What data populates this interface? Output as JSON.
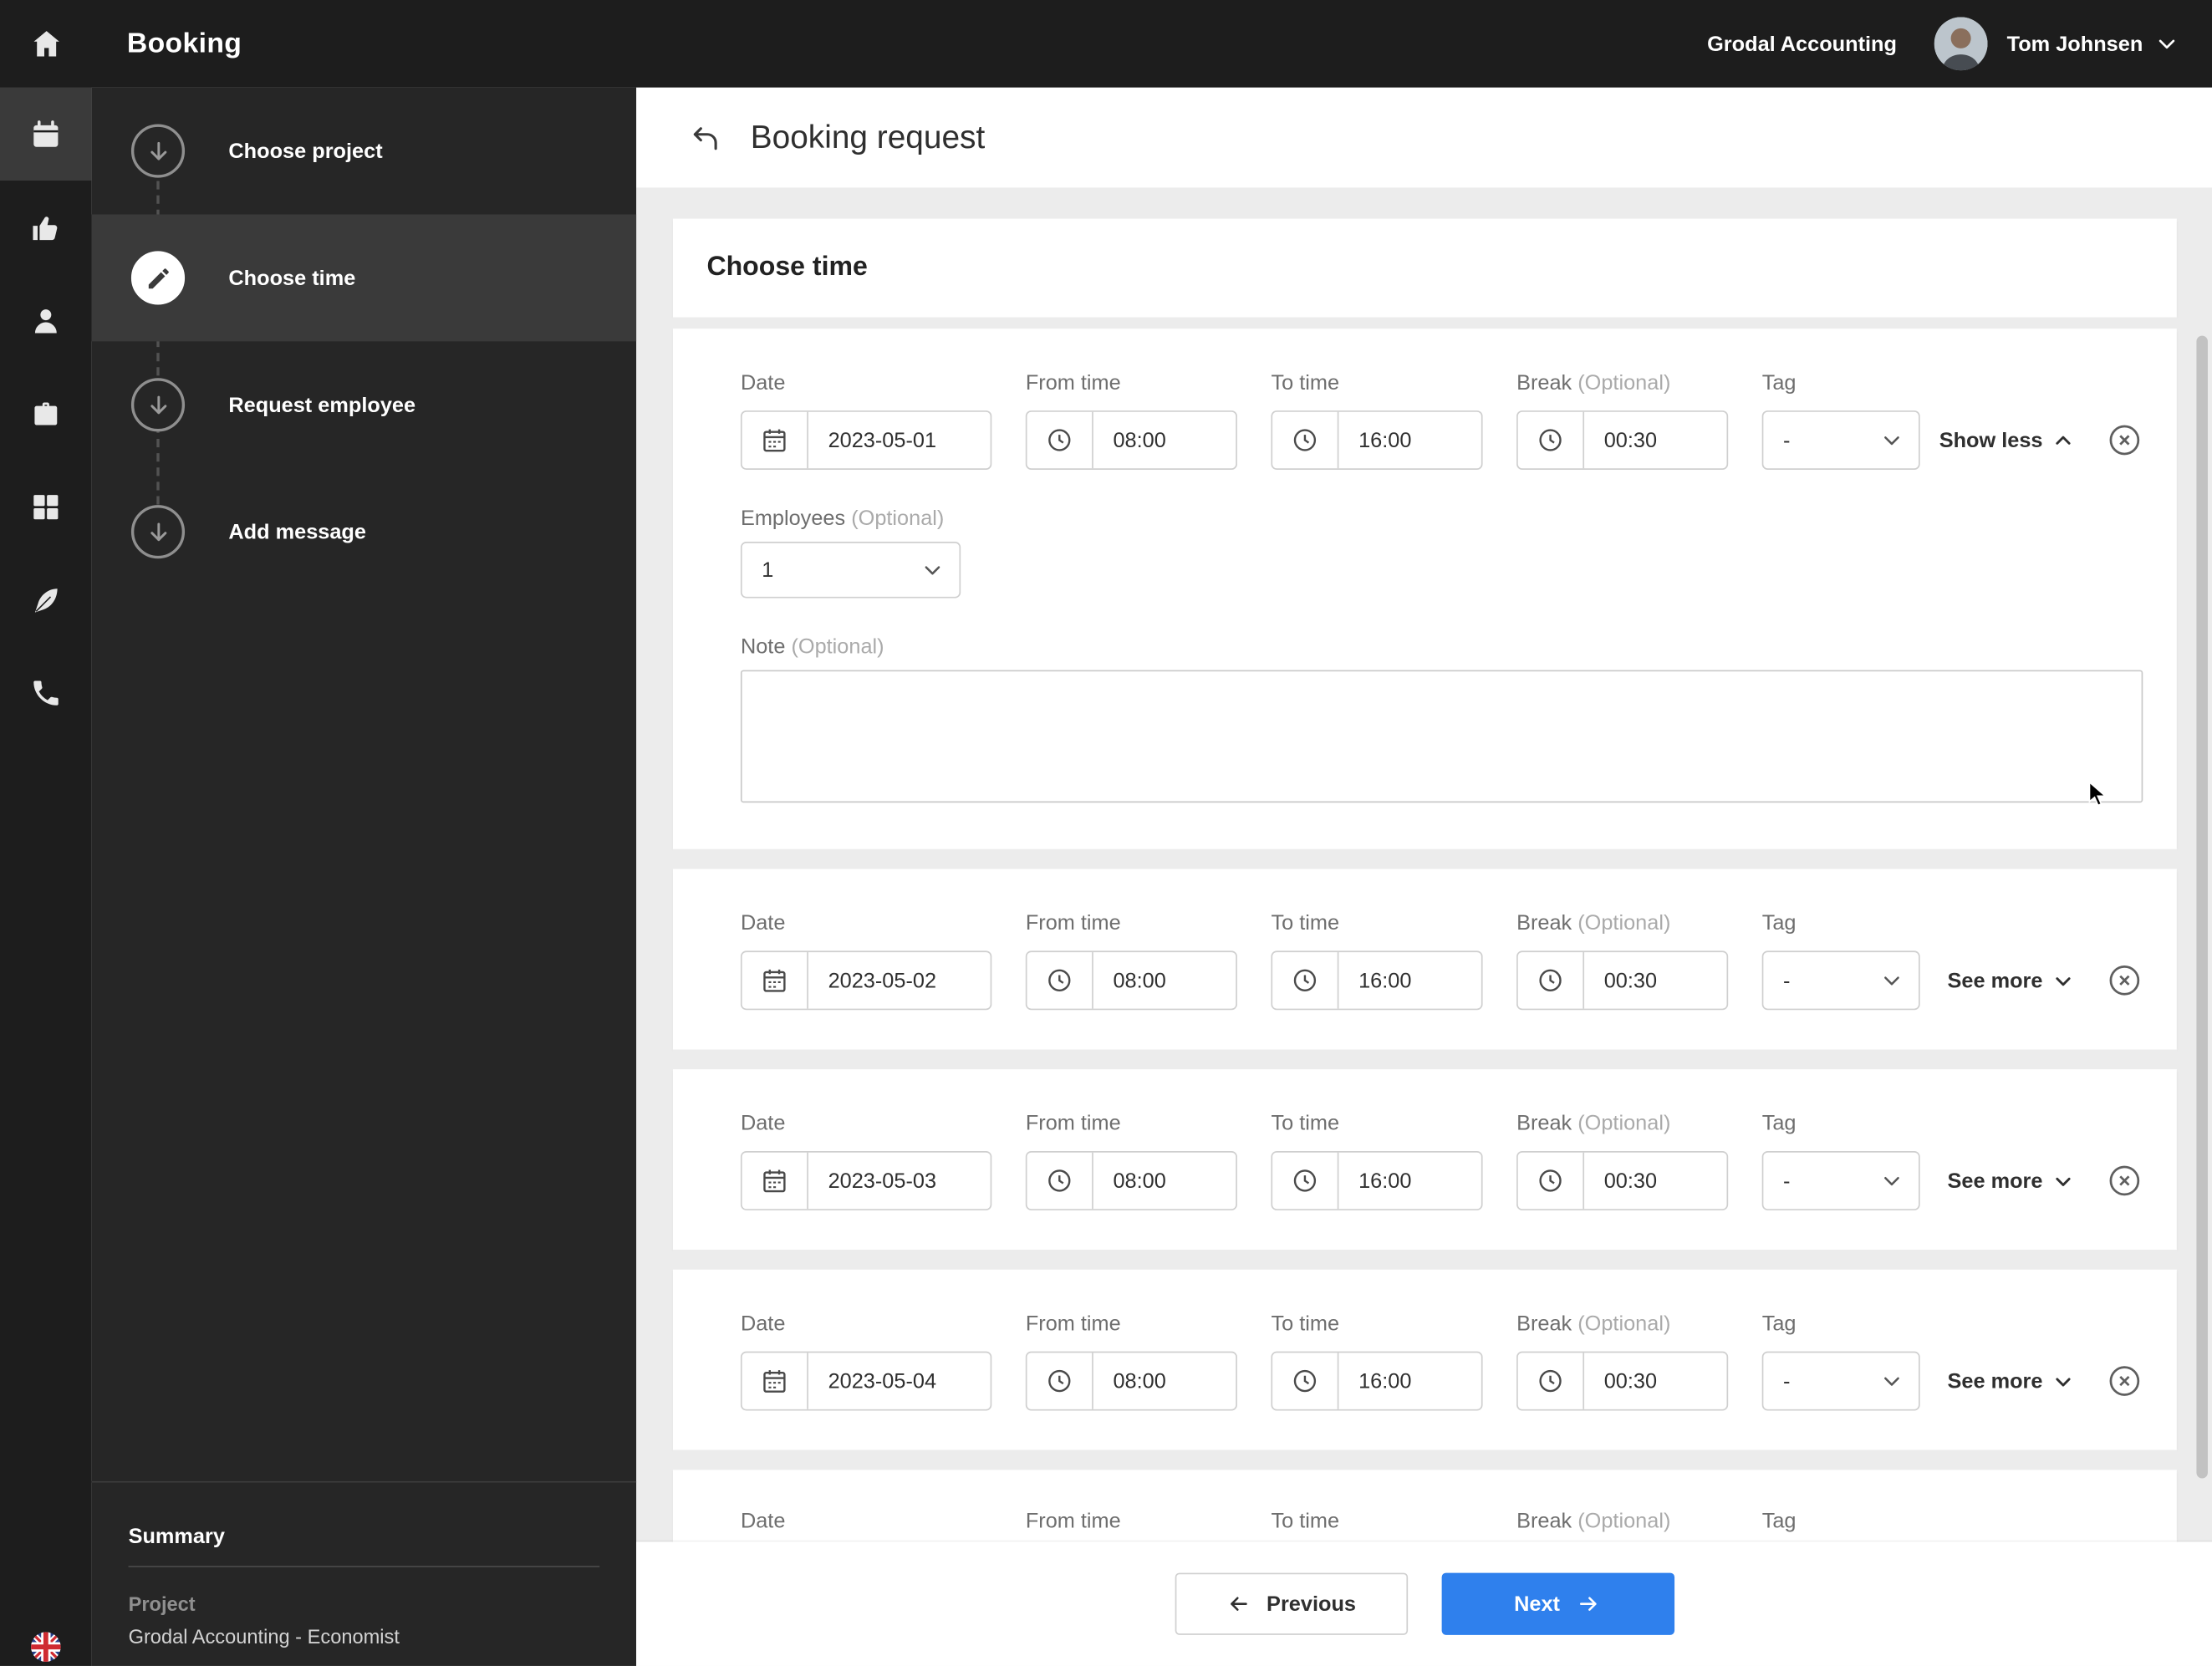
{
  "topbar": {
    "title": "Booking",
    "company": "Grodal Accounting",
    "user": "Tom Johnsen"
  },
  "rail_icons": [
    "home-icon",
    "calendar-icon",
    "thumbs-up-icon",
    "person-icon",
    "briefcase-icon",
    "grid-icon",
    "feather-icon",
    "phone-icon",
    "uk-flag-icon"
  ],
  "stepper": {
    "steps": [
      {
        "label": "Choose project"
      },
      {
        "label": "Choose time"
      },
      {
        "label": "Request employee"
      },
      {
        "label": "Add message"
      }
    ],
    "summary": {
      "heading": "Summary",
      "project_label": "Project",
      "project_value": "Grodal Accounting - Economist"
    }
  },
  "main": {
    "page_title": "Booking request",
    "section_title": "Choose time",
    "labels": {
      "date": "Date",
      "from_time": "From time",
      "to_time": "To time",
      "break": "Break",
      "tag": "Tag",
      "optional": "(Optional)",
      "employees": "Employees",
      "note": "Note"
    },
    "rows": [
      {
        "date": "2023-05-01",
        "from": "08:00",
        "to": "16:00",
        "break": "00:30",
        "tag": "-",
        "toggle": "Show less",
        "employees": "1",
        "note": ""
      },
      {
        "date": "2023-05-02",
        "from": "08:00",
        "to": "16:00",
        "break": "00:30",
        "tag": "-",
        "toggle": "See more"
      },
      {
        "date": "2023-05-03",
        "from": "08:00",
        "to": "16:00",
        "break": "00:30",
        "tag": "-",
        "toggle": "See more"
      },
      {
        "date": "2023-05-04",
        "from": "08:00",
        "to": "16:00",
        "break": "00:30",
        "tag": "-",
        "toggle": "See more"
      }
    ],
    "footer": {
      "previous": "Previous",
      "next": "Next"
    }
  },
  "colors": {
    "accent": "#2f80ed",
    "topbar_bg": "#1d1d1d",
    "sidebar_bg": "#262626",
    "page_bg": "#ececec"
  }
}
